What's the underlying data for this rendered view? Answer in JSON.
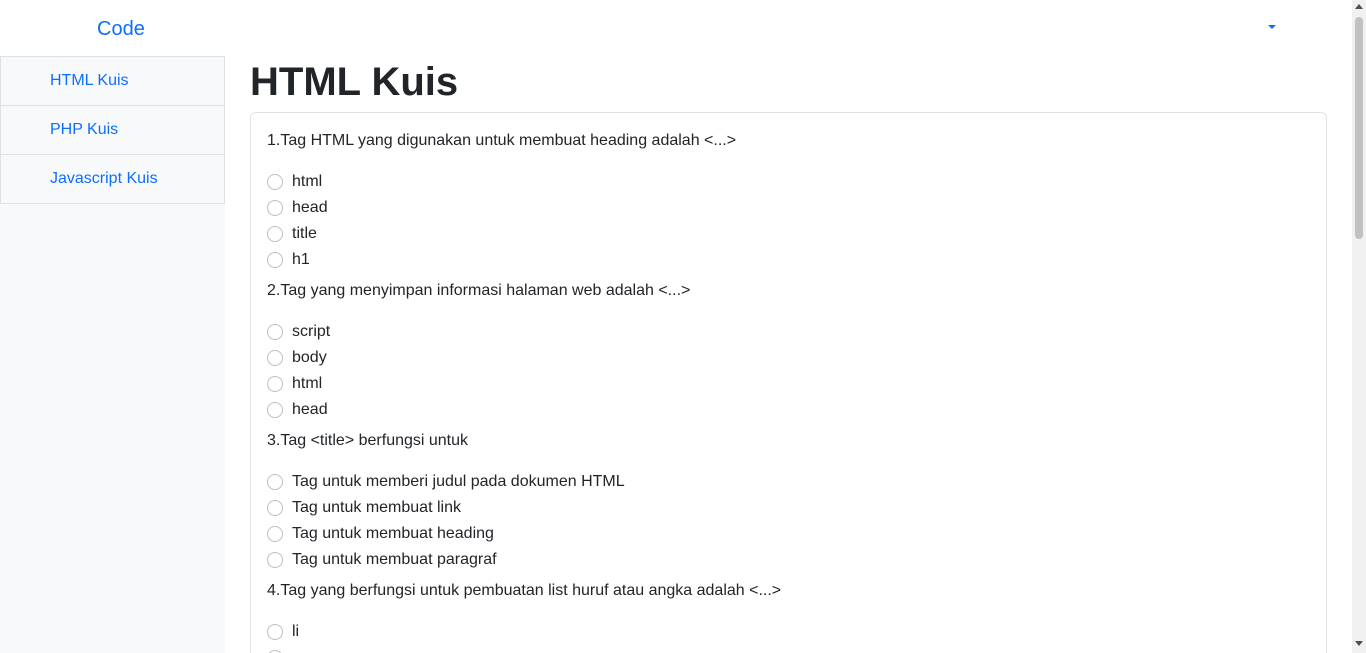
{
  "navbar": {
    "brand": "Code",
    "dropdown_icon": "caret-down-icon"
  },
  "sidebar": {
    "items": [
      {
        "label": "HTML Kuis"
      },
      {
        "label": "PHP Kuis"
      },
      {
        "label": "Javascript Kuis"
      }
    ]
  },
  "main": {
    "title": "HTML Kuis",
    "questions": [
      {
        "text": "1.Tag HTML yang digunakan untuk membuat heading adalah <...>",
        "options": [
          "html",
          "head",
          "title",
          "h1"
        ]
      },
      {
        "text": "2.Tag yang menyimpan informasi halaman web adalah <...>",
        "options": [
          "script",
          "body",
          "html",
          "head"
        ]
      },
      {
        "text": "3.Tag <title> berfungsi untuk",
        "options": [
          "Tag untuk memberi judul pada dokumen HTML",
          "Tag untuk membuat link",
          "Tag untuk membuat heading",
          "Tag untuk membuat paragraf"
        ]
      },
      {
        "text": "4.Tag yang berfungsi untuk pembuatan list huruf atau angka adalah <...>",
        "options": [
          "li",
          ""
        ]
      }
    ]
  },
  "colors": {
    "accent": "#0d6efd",
    "text": "#212529",
    "sidebar_bg": "#f8f9fa",
    "border": "#dee2e6"
  }
}
